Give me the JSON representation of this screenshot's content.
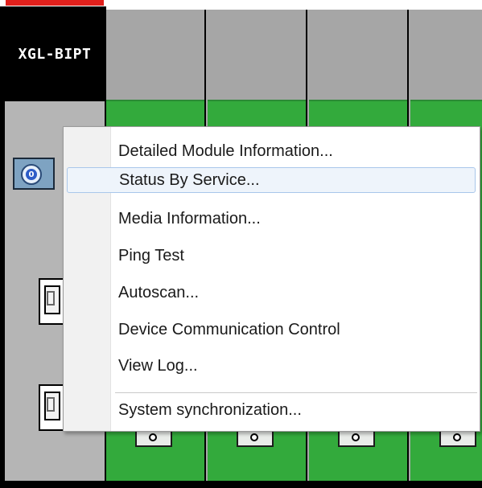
{
  "module": {
    "label": "XGL-BIPT",
    "status_icon": "rotary-switch-icon",
    "status_icon_glyph": "0",
    "ports": [
      "ethernet-port-icon",
      "ethernet-port-icon"
    ]
  },
  "slots": [
    {
      "connector_icon": "terminal-connector-icon"
    },
    {
      "connector_icon": "terminal-connector-icon"
    },
    {
      "connector_icon": "terminal-connector-icon"
    },
    {
      "connector_icon": "terminal-connector-icon"
    }
  ],
  "context_menu": {
    "items": [
      {
        "label": "Detailed Module Information...",
        "highlighted": false
      },
      {
        "label": "Status By Service...",
        "highlighted": true
      },
      {
        "label": "Media Information...",
        "highlighted": false
      },
      {
        "label": "Ping Test",
        "highlighted": false
      },
      {
        "label": "Autoscan...",
        "highlighted": false
      },
      {
        "label": "Device Communication Control",
        "highlighted": false
      },
      {
        "label": "View Log...",
        "highlighted": false
      },
      {
        "label": "System synchronization...",
        "highlighted": false
      }
    ]
  },
  "colors": {
    "module_label_bg": "#000000",
    "slot_green": "#33aa3c",
    "highlight_bg": "#eef4fb",
    "highlight_border": "#a9c7ea",
    "top_strip_red": "#e0201c"
  }
}
